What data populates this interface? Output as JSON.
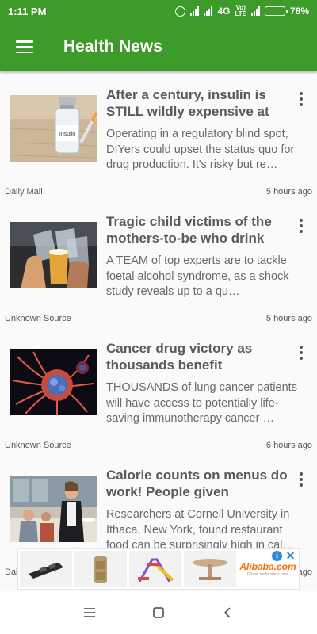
{
  "status_bar": {
    "time": "1:11 PM",
    "network": "4G",
    "volte_top": "Vo)",
    "volte_bottom": "LTE",
    "battery_text": "78%",
    "battery_level": 0.78
  },
  "app_bar": {
    "title": "Health News",
    "menu_icon": "hamburger-menu-icon",
    "color": "#3d9b29"
  },
  "articles": [
    {
      "headline": "After a century, insulin is STILL wildly expensive at $…",
      "summary": "Operating in a regulatory blind spot, DIYers could upset the status quo for drug production. It's risky but re…",
      "source": "Daily Mail",
      "age": "5 hours ago",
      "image": "insulin-vial-image"
    },
    {
      "headline": "Tragic child victims of the mothers-to-be who drink",
      "summary": "A TEAM of top experts are to tackle foetal alcohol syndrome, as a shock study reveals up to a qu…",
      "source": "Unknown Source",
      "age": "5 hours ago",
      "image": "beer-glasses-image"
    },
    {
      "headline": "Cancer drug victory as thousands benefit",
      "summary": "THOUSANDS of lung cancer patients will have access to potentially life-saving immunotherapy cancer …",
      "source": "Unknown Source",
      "age": "6 hours ago",
      "image": "cancer-cell-image"
    },
    {
      "headline": "Calorie counts on menus do work! People given nutritio…",
      "summary": "Researchers at Cornell University in Ithaca, New York, found restaurant food can be surprisingly high in cal…",
      "source": "Daily Mail",
      "age": "6 hours ago",
      "image": "restaurant-image"
    }
  ],
  "ad": {
    "brand": "Alibaba.com",
    "tagline": "Global trade starts here",
    "info_label": "i",
    "close_label": "✕"
  },
  "nav": {
    "recents": "recents-icon",
    "home": "home-icon",
    "back": "back-icon"
  }
}
